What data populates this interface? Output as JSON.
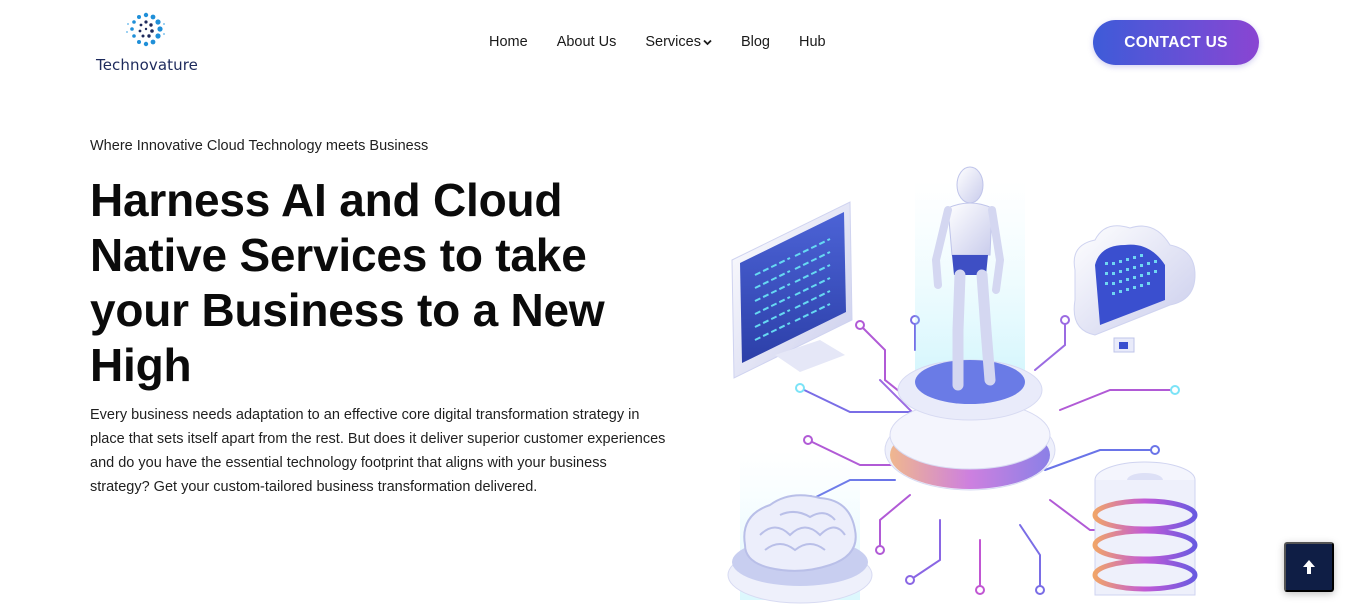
{
  "brand": {
    "name": "Technovature",
    "colors": {
      "dark": "#1d2a5c",
      "accent": "#2a8fd6"
    }
  },
  "nav": {
    "items": [
      {
        "label": "Home"
      },
      {
        "label": "About Us"
      },
      {
        "label": "Services",
        "has_dropdown": true
      },
      {
        "label": "Blog"
      },
      {
        "label": "Hub"
      }
    ]
  },
  "cta": {
    "label": "CONTACT US",
    "gradient": [
      "#3e5bd8",
      "#8a45d2"
    ]
  },
  "hero": {
    "eyebrow": "Where Innovative Cloud Technology meets Business",
    "headline": "Harness AI and Cloud Native Services to take your Business to a New High",
    "description": "Every business needs adaptation to an effective core digital transformation strategy in place that sets itself apart from the rest. But does it deliver superior customer experiences and do you have the essential technology footprint that aligns with your business strategy? Get your custom-tailored business transformation delivered."
  },
  "illustration": {
    "elements": [
      "monitor-icon",
      "robot-icon",
      "cloud-icon",
      "brain-icon",
      "database-icon",
      "circuit-lines"
    ]
  },
  "back_to_top": {
    "icon": "arrow-up-icon",
    "color": "#0f1e45"
  }
}
